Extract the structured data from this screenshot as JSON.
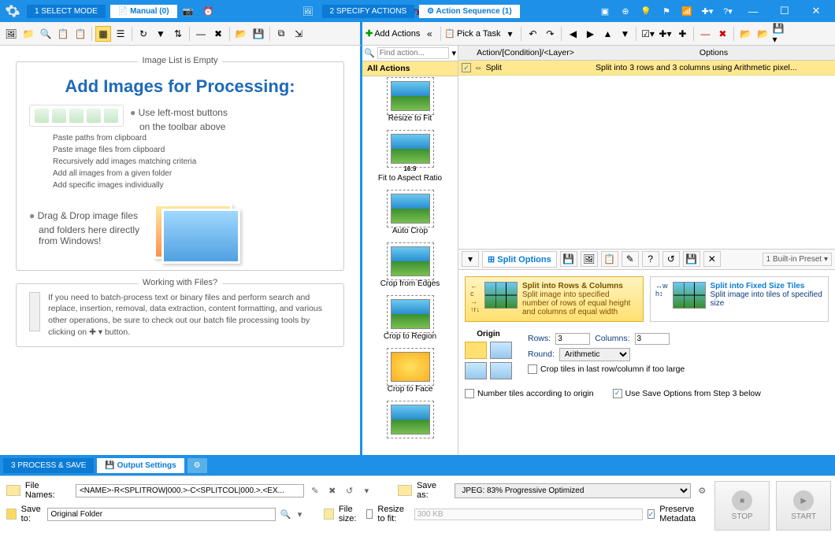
{
  "brand": "BinaryMark",
  "titlebar": {
    "step1": "1 SELECT MODE",
    "manual_tab": "Manual (0)",
    "step2": "2 SPECIFY ACTIONS",
    "sequence_tab": "Action Sequence (1)"
  },
  "left": {
    "empty_legend": "Image List is Empty",
    "heading": "Add Images for Processing:",
    "bullet1a": "Use left-most buttons",
    "bullet1b": "on the toolbar above",
    "arrows": [
      "Paste paths from clipboard",
      "Paste image files from clipboard",
      "Recursively add images matching criteria",
      "Add all images from a given folder",
      "Add specific images individually"
    ],
    "bullet2a": "Drag & Drop image files",
    "bullet2b": "and folders here directly",
    "bullet2c": "from Windows!",
    "files_legend": "Working with Files?",
    "files_text": "If you need to batch-process text or binary files and perform search and replace, insertion, removal, data extraction, content formatting, and various other operations, be sure to check out our batch file processing tools by clicking on  ✚ ▾  button."
  },
  "actions": {
    "add_label": "Add Actions",
    "find_placeholder": "Find action...",
    "all_tab": "All Actions",
    "items": [
      "Resize to Fit",
      "Fit to Aspect Ratio",
      "Auto Crop",
      "Crop from Edges",
      "Crop to Region",
      "Crop to Face",
      ""
    ],
    "aspect_label": "16:9"
  },
  "seq": {
    "pick_task": "Pick a Task",
    "col1": "Action/[Condition]/<Layer>",
    "col2": "Options",
    "row_name": "Split",
    "row_desc": "Split into 3 rows and 3 columns using Arithmetic pixel..."
  },
  "opts": {
    "title": "Split Options",
    "preset": "1 Built-in Preset",
    "mode1_title": "Split into Rows & Columns",
    "mode1_desc": "Split image into specified number of rows of equal height and columns of equal width",
    "mode2_title": "Split into Fixed Size Tiles",
    "mode2_desc": "Split image into tiles of specified size",
    "origin_label": "Origin",
    "rows_label": "Rows:",
    "rows_value": 3,
    "cols_label": "Columns:",
    "cols_value": 3,
    "round_label": "Round:",
    "round_value": "Arithmetic",
    "crop_chk": "Crop tiles in last row/column if too large",
    "number_chk": "Number tiles according to origin",
    "usesave_chk": "Use Save Options from Step 3 below"
  },
  "footer": {
    "step3": "3 PROCESS & SAVE",
    "output_tab": "Output Settings",
    "filenames_label": "File Names:",
    "filenames_value": "<NAME>-R<SPLITROW|000.>-C<SPLITCOL|000.>.<EX...",
    "saveto_label": "Save to:",
    "saveto_value": "Original Folder",
    "saveas_label": "Save as:",
    "saveas_value": "JPEG: 83%  Progressive Optimized",
    "filesize_label": "File size:",
    "resize_chk": "Resize to fit:",
    "resize_value": "300 KB",
    "preserve_chk": "Preserve Metadata",
    "stop": "STOP",
    "start": "START"
  }
}
